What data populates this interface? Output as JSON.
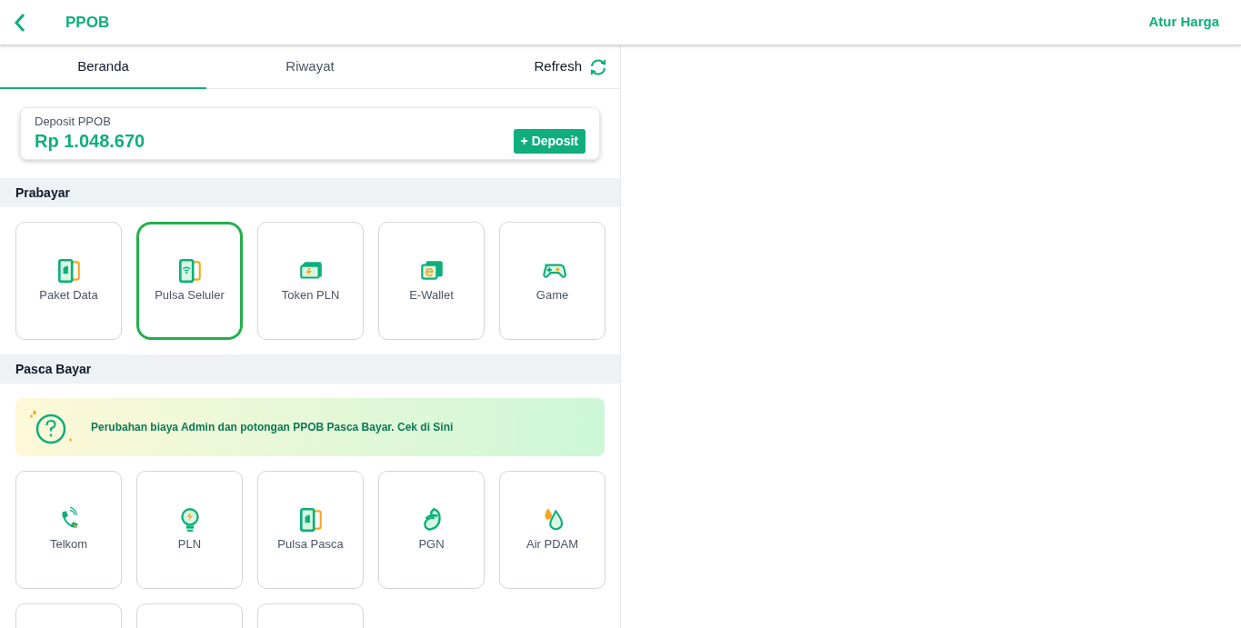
{
  "header": {
    "title": "PPOB",
    "action": "Atur Harga"
  },
  "tabs": [
    {
      "label": "Beranda",
      "selected": true
    },
    {
      "label": "Riwayat",
      "selected": false
    }
  ],
  "refresh": {
    "label": "Refresh"
  },
  "deposit": {
    "label": "Deposit PPOB",
    "amount": "Rp 1.048.670",
    "button": "+ Deposit"
  },
  "prepaid": {
    "title": "Prabayar",
    "items": [
      {
        "label": "Paket Data",
        "kind": "sim",
        "selected": false
      },
      {
        "label": "Pulsa Seluler",
        "kind": "phone",
        "selected": true
      },
      {
        "label": "Token PLN",
        "kind": "token",
        "selected": false
      },
      {
        "label": "E-Wallet",
        "kind": "wallet",
        "selected": false
      },
      {
        "label": "Game",
        "kind": "game",
        "selected": false
      }
    ]
  },
  "postpaid": {
    "title": "Pasca Bayar",
    "notice": "Perubahan biaya Admin dan potongan PPOB Pasca Bayar. **Cek di Sini**",
    "items": [
      {
        "label": "Telkom",
        "kind": "telephone",
        "selected": false
      },
      {
        "label": "PLN",
        "kind": "bulb",
        "selected": false
      },
      {
        "label": "Pulsa Pasca",
        "kind": "sim",
        "selected": false
      },
      {
        "label": "PGN",
        "kind": "gas",
        "selected": false
      },
      {
        "label": "Air PDAM",
        "kind": "water",
        "selected": false
      },
      {
        "kind": "cut",
        "selected": false
      },
      {
        "kind": "cut",
        "selected": false
      },
      {
        "kind": "cut",
        "selected": false
      }
    ]
  }
}
